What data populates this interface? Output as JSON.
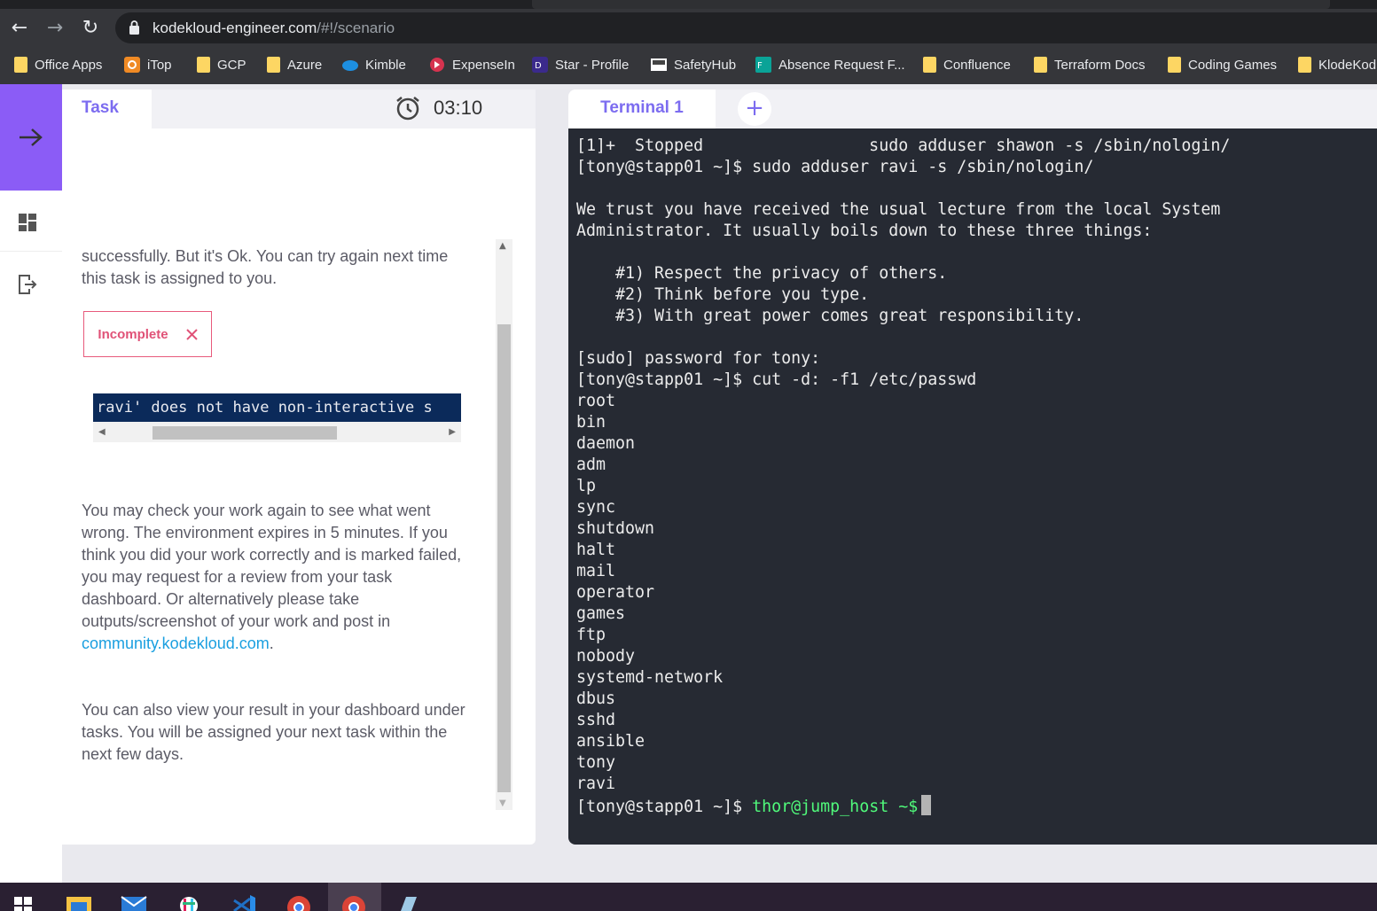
{
  "browser": {
    "url_host": "kodekloud-engineer.com",
    "url_path": "/#!/scenario",
    "bookmarks": [
      {
        "label": "Office Apps",
        "icon": "folder-icon"
      },
      {
        "label": "iTop",
        "icon": "itop-icon"
      },
      {
        "label": "GCP",
        "icon": "folder-icon"
      },
      {
        "label": "Azure",
        "icon": "folder-icon"
      },
      {
        "label": "Kimble",
        "icon": "cloud-icon"
      },
      {
        "label": "ExpenseIn",
        "icon": "expensein-icon"
      },
      {
        "label": "Star - Profile",
        "icon": "star-profile-icon"
      },
      {
        "label": "SafetyHub",
        "icon": "safetyhub-icon"
      },
      {
        "label": "Absence Request F...",
        "icon": "forms-icon"
      },
      {
        "label": "Confluence",
        "icon": "folder-icon"
      },
      {
        "label": "Terraform Docs",
        "icon": "folder-icon"
      },
      {
        "label": "Coding Games",
        "icon": "folder-icon"
      },
      {
        "label": "KlodeKod",
        "icon": "folder-icon"
      }
    ]
  },
  "task": {
    "tab_label": "Task",
    "timer": "03:10",
    "para1": "successfully. But it's Ok. You can try again next time this task is assigned to you.",
    "status_badge": "Incomplete",
    "code_line": "ravi' does not have non-interactive s",
    "para2_text": "You may check your work again to see what went wrong. The environment expires in 5 minutes. If you think you did your work correctly and is marked failed, you may request for a review from your task dashboard. Or alternatively please take outputs/screenshot of your work and post in ",
    "para2_link": "community.kodekloud.com",
    "para2_end": ".",
    "para3": "You can also view your result in your dashboard under tasks. You will be assigned your next task within the next few days."
  },
  "terminal": {
    "tab_label": "Terminal 1",
    "add_label": "+",
    "output": "[1]+  Stopped                 sudo adduser shawon -s /sbin/nologin/\n[tony@stapp01 ~]$ sudo adduser ravi -s /sbin/nologin/\n\nWe trust you have received the usual lecture from the local System\nAdministrator. It usually boils down to these three things:\n\n    #1) Respect the privacy of others.\n    #2) Think before you type.\n    #3) With great power comes great responsibility.\n\n[sudo] password for tony:\n[tony@stapp01 ~]$ cut -d: -f1 /etc/passwd\nroot\nbin\ndaemon\nadm\nlp\nsync\nshutdown\nhalt\nmail\noperator\ngames\nftp\nnobody\nsystemd-network\ndbus\nsshd\nansible\ntony\nravi\n",
    "prompt1": "[tony@stapp01 ~]$ ",
    "prompt2": "thor@jump_host ~$"
  },
  "colors": {
    "accent": "#7c6cf0",
    "sidebar_accent": "#8b5cf6",
    "terminal_bg": "#262a33",
    "badge": "#e05277",
    "link": "#1a9fe0"
  }
}
